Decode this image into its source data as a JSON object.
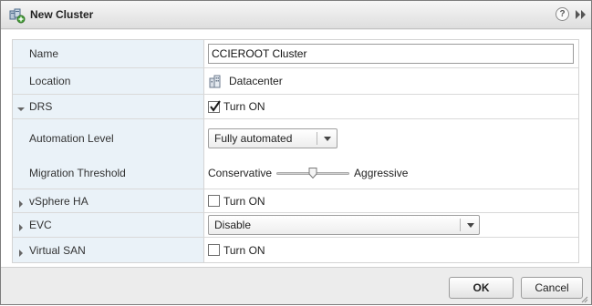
{
  "window": {
    "title": "New Cluster",
    "icons": {
      "title": "cluster-icon",
      "help": "help-icon",
      "expand": "expand-icon"
    },
    "help_glyph": "?"
  },
  "form": {
    "name": {
      "label": "Name",
      "value": "CCIEROOT Cluster"
    },
    "location": {
      "label": "Location",
      "value": "Datacenter",
      "icon": "datacenter-icon"
    },
    "drs": {
      "label": "DRS",
      "expanded": true,
      "checkbox_label": "Turn ON",
      "checked": true
    },
    "automation_level": {
      "label": "Automation Level",
      "selected": "Fully automated"
    },
    "migration_threshold": {
      "label": "Migration Threshold",
      "min_label": "Conservative",
      "max_label": "Aggressive",
      "level": 0.5
    },
    "vsphere_ha": {
      "label": "vSphere HA",
      "expanded": false,
      "checkbox_label": "Turn ON",
      "checked": false
    },
    "evc": {
      "label": "EVC",
      "expanded": false,
      "selected": "Disable"
    },
    "virtual_san": {
      "label": "Virtual SAN",
      "expanded": false,
      "checkbox_label": "Turn ON",
      "checked": false
    }
  },
  "footer": {
    "ok_label": "OK",
    "cancel_label": "Cancel"
  }
}
